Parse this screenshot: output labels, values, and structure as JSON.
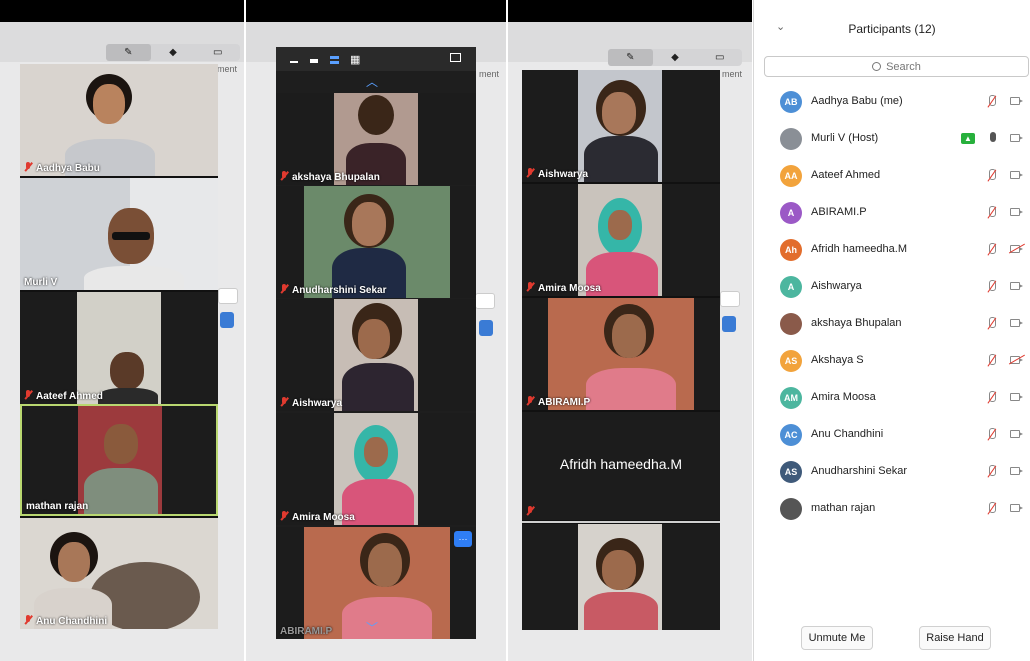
{
  "panel1": {
    "tiles": [
      {
        "name": "Aadhya Babu",
        "muted": true
      },
      {
        "name": "Murli V",
        "muted": false
      },
      {
        "name": "Aateef Ahmed",
        "muted": true
      },
      {
        "name": "mathan rajan",
        "muted": false
      },
      {
        "name": "Anu Chandhini",
        "muted": true
      }
    ],
    "clip_text": "ment"
  },
  "panel2": {
    "tiles": [
      {
        "name": "akshaya Bhupalan",
        "muted": true
      },
      {
        "name": "Anudharshini Sekar",
        "muted": true
      },
      {
        "name": "Aishwarya",
        "muted": true
      },
      {
        "name": "Amira Moosa",
        "muted": true
      },
      {
        "name": "ABIRAMI.P",
        "muted": false
      }
    ],
    "clip_text": "ment",
    "more_label": "···"
  },
  "panel3": {
    "tiles": [
      {
        "name": "Aishwarya",
        "muted": true
      },
      {
        "name": "Amira Moosa",
        "muted": true
      },
      {
        "name": "ABIRAMI.P",
        "muted": true
      },
      {
        "name": "",
        "muted": true,
        "center_name": "Afridh hameedha.M"
      },
      {
        "name": "",
        "muted": false
      }
    ],
    "clip_text": "ment"
  },
  "participants": {
    "title": "Participants (12)",
    "search_placeholder": "Search",
    "share_glyph": "▲",
    "list": [
      {
        "initials": "AB",
        "name": "Aadhya Babu (me)",
        "color": "#4d8fd6",
        "muted": true,
        "video_off": false
      },
      {
        "initials": "",
        "name": "Murli V (Host)",
        "color": "#8a8f96",
        "muted": false,
        "video_off": false,
        "sharing": true
      },
      {
        "initials": "AA",
        "name": "Aateef Ahmed",
        "color": "#f2a33c",
        "muted": true,
        "video_off": false
      },
      {
        "initials": "A",
        "name": "ABIRAMI.P",
        "color": "#9b59c6",
        "muted": true,
        "video_off": false
      },
      {
        "initials": "Ah",
        "name": "Afridh hameedha.M",
        "color": "#e26d2c",
        "muted": true,
        "video_off": true
      },
      {
        "initials": "A",
        "name": "Aishwarya",
        "color": "#4cb69f",
        "muted": true,
        "video_off": false
      },
      {
        "initials": "",
        "name": "akshaya Bhupalan",
        "color": "#8a5a4a",
        "muted": true,
        "video_off": false
      },
      {
        "initials": "AS",
        "name": "Akshaya S",
        "color": "#f2a33c",
        "muted": true,
        "video_off": true
      },
      {
        "initials": "AM",
        "name": "Amira Moosa",
        "color": "#4cb69f",
        "muted": true,
        "video_off": false
      },
      {
        "initials": "AC",
        "name": "Anu Chandhini",
        "color": "#4d8fd6",
        "muted": true,
        "video_off": false
      },
      {
        "initials": "AS",
        "name": "Anudharshini Sekar",
        "color": "#3f5a7a",
        "muted": true,
        "video_off": false
      },
      {
        "initials": "",
        "name": "mathan rajan",
        "color": "#555555",
        "muted": true,
        "video_off": false
      }
    ],
    "buttons": {
      "unmute": "Unmute Me",
      "raise_hand": "Raise Hand"
    }
  }
}
